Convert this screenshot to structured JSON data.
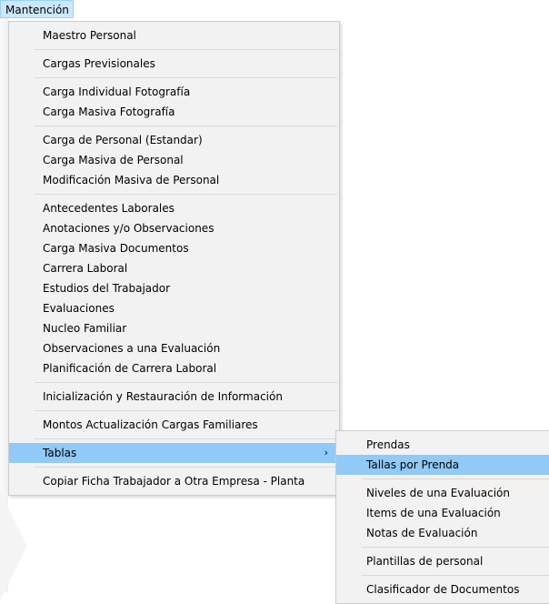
{
  "menubar": {
    "title": "Mantención"
  },
  "menu": {
    "groups": [
      [
        "Maestro Personal"
      ],
      [
        "Cargas Previsionales"
      ],
      [
        "Carga Individual Fotografía",
        "Carga Masiva Fotografía"
      ],
      [
        "Carga de Personal (Estandar)",
        "Carga Masiva de Personal",
        "Modificación Masiva de Personal"
      ],
      [
        "Antecedentes Laborales",
        "Anotaciones y/o Observaciones",
        "Carga Masiva Documentos",
        "Carrera Laboral",
        "Estudios del Trabajador",
        "Evaluaciones",
        "Nucleo Familiar",
        "Observaciones a una Evaluación",
        "Planificación de Carrera Laboral"
      ],
      [
        "Inicialización y Restauración de Información"
      ],
      [
        "Montos Actualización Cargas Familiares"
      ],
      [
        "Tablas"
      ],
      [
        "Copiar Ficha Trabajador a Otra Empresa - Planta"
      ]
    ],
    "active_item": "Tablas",
    "submenu_arrow": "›"
  },
  "submenu": {
    "groups": [
      [
        "Prendas",
        "Tallas por Prenda"
      ],
      [
        "Niveles de una Evaluación",
        "Items de una Evaluación",
        "Notas de Evaluación"
      ],
      [
        "Plantillas de personal"
      ],
      [
        "Clasificador de Documentos"
      ]
    ],
    "active_item": "Tallas por Prenda"
  },
  "colors": {
    "highlight": "#91c9f7",
    "menu_bg": "#f2f2f2",
    "separator": "#d7d7d7"
  }
}
